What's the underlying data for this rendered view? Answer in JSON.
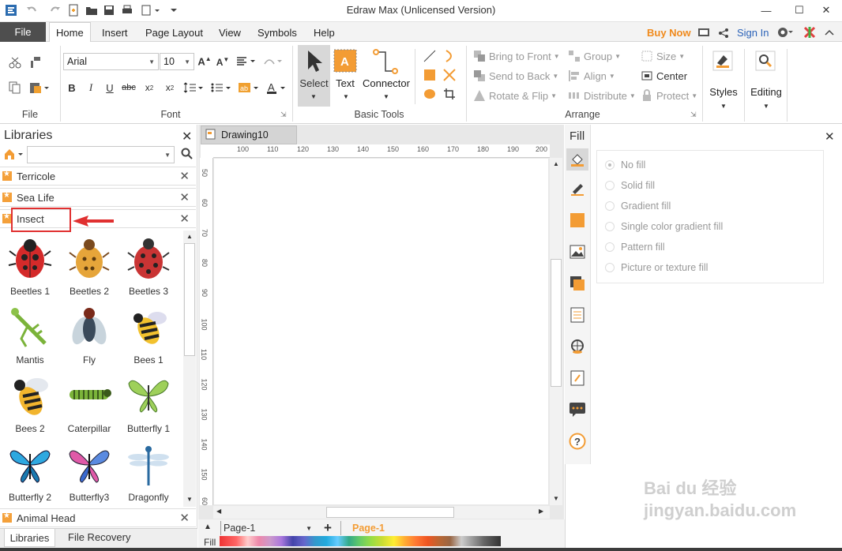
{
  "window": {
    "title": "Edraw Max (Unlicensed Version)"
  },
  "menu": {
    "file": "File",
    "tabs": [
      "Home",
      "Insert",
      "Page Layout",
      "View",
      "Symbols",
      "Help"
    ],
    "buy_now": "Buy Now",
    "sign_in": "Sign In"
  },
  "ribbon": {
    "file_group": "File",
    "font_group": "Font",
    "font_name": "Arial",
    "font_size": "10",
    "basic_tools_group": "Basic Tools",
    "select_label": "Select",
    "text_label": "Text",
    "connector_label": "Connector",
    "arrange_group": "Arrange",
    "bring_to_front": "Bring to Front",
    "send_to_back": "Send to Back",
    "rotate_flip": "Rotate & Flip",
    "group": "Group",
    "align": "Align",
    "distribute": "Distribute",
    "size": "Size",
    "center": "Center",
    "protect": "Protect",
    "styles": "Styles",
    "editing": "Editing"
  },
  "libraries": {
    "title": "Libraries",
    "sections": [
      "Terricole",
      "Sea Life",
      "Insect",
      "Animal Head"
    ],
    "shapes": [
      "Beetles 1",
      "Beetles 2",
      "Beetles 3",
      "Mantis",
      "Fly",
      "Bees 1",
      "Bees 2",
      "Caterpillar",
      "Butterfly 1",
      "Butterfly 2",
      "Butterfly3",
      "Dragonfly"
    ],
    "tab_libraries": "Libraries",
    "tab_recovery": "File Recovery"
  },
  "document": {
    "tab": "Drawing10",
    "ruler_h": [
      "100",
      "110",
      "120",
      "130",
      "140",
      "150",
      "160",
      "170",
      "180",
      "190",
      "200"
    ],
    "ruler_v": [
      "50",
      "60",
      "70",
      "80",
      "90",
      "100",
      "110",
      "120",
      "130",
      "140",
      "150",
      "60"
    ],
    "page_select": "Page-1",
    "page_tab": "Page-1",
    "fill_label": "Fill"
  },
  "fill_panel": {
    "title": "Fill",
    "options": [
      "No fill",
      "Solid fill",
      "Gradient fill",
      "Single color gradient fill",
      "Pattern fill",
      "Picture or texture fill"
    ]
  },
  "watermark": "Bai du 经验 jingyan.baidu.com",
  "colors": {
    "accent": "#f0a030",
    "highlight_box": "#e03030",
    "file_tab": "#4e4e4e"
  }
}
